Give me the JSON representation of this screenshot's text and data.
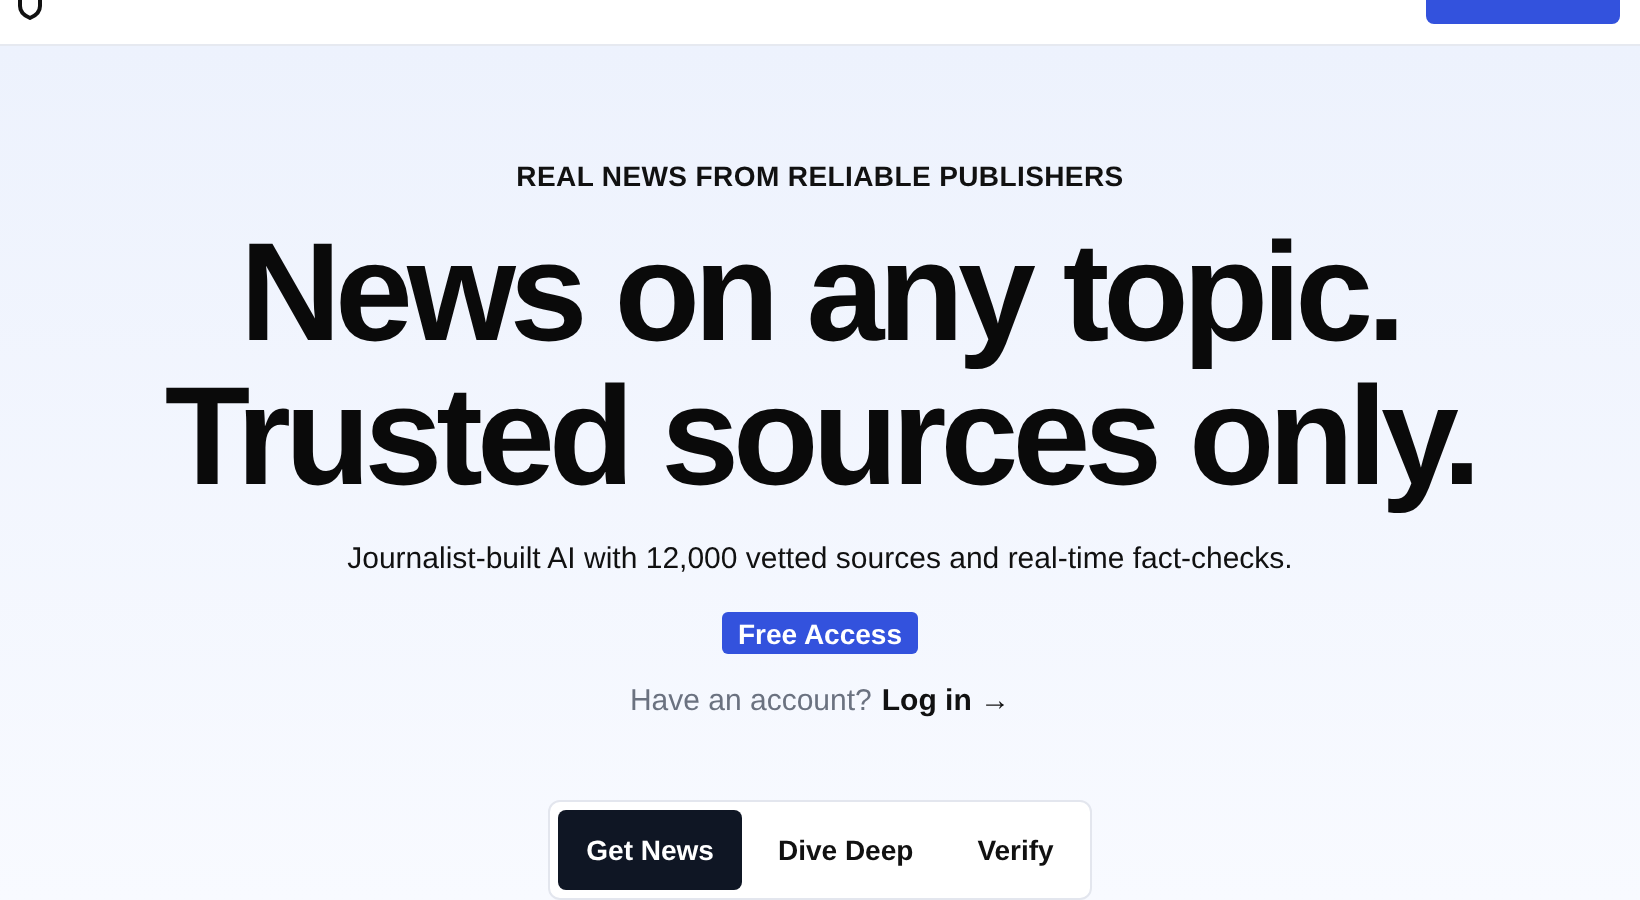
{
  "hero": {
    "eyebrow": "REAL NEWS FROM RELIABLE PUBLISHERS",
    "headline": [
      "News on any topic.",
      "Trusted sources only."
    ],
    "subtitle": "Journalist-built AI with 12,000 vetted sources and real-time fact-checks.",
    "cta": "Free Access",
    "account_prompt": "Have an account?",
    "login_link": "Log in →"
  },
  "tabs": [
    {
      "label": "Get News",
      "selected": true
    },
    {
      "label": "Dive Deep",
      "selected": false
    },
    {
      "label": "Verify",
      "selected": false
    }
  ]
}
